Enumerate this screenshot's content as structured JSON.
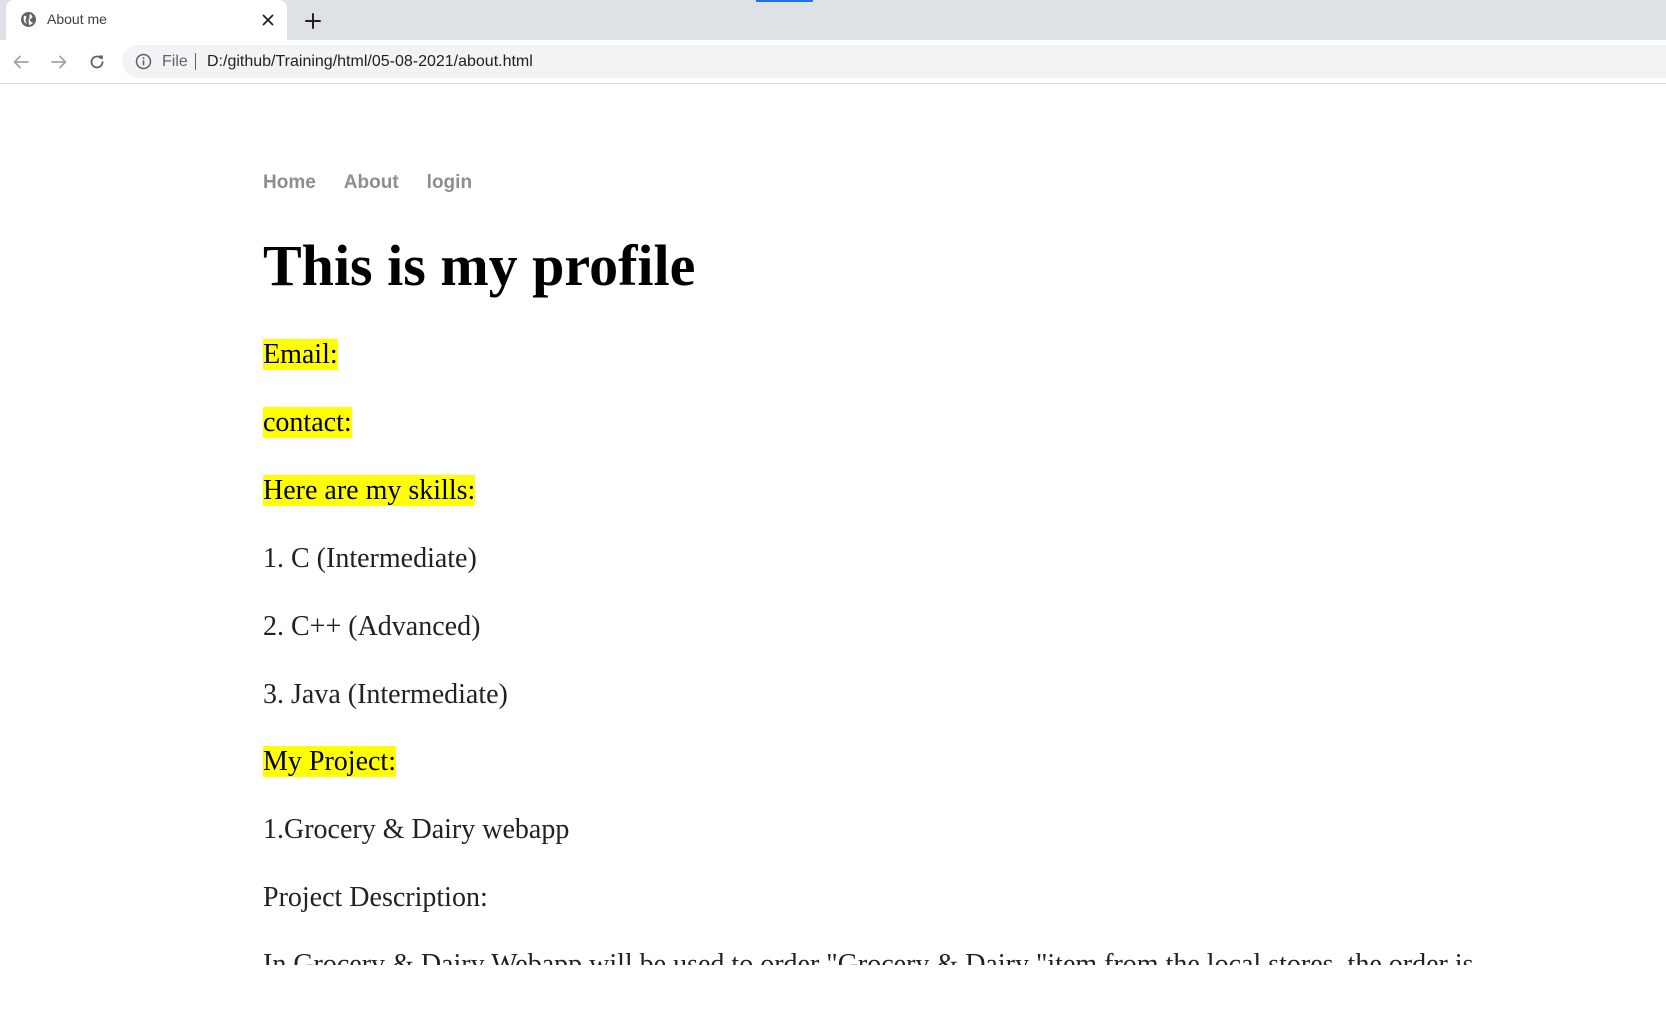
{
  "browser": {
    "tab_title": "About me",
    "url_scheme": "File",
    "url": "D:/github/Training/html/05-08-2021/about.html"
  },
  "page": {
    "nav": [
      "Home",
      "About",
      "login"
    ],
    "title": "This is my profile",
    "email_label": "Email:",
    "contact_label": "contact:",
    "skills_label": "Here are my skills:",
    "skills": [
      "1. C (Intermediate)",
      "2. C++ (Advanced)",
      "3. Java (Intermediate)"
    ],
    "project_label": "My Project:",
    "project_name": "1.Grocery & Dairy webapp",
    "project_desc_label": "Project Description:",
    "project_desc_text": "In Grocery & Dairy Webapp will be used to order \"Grocery & Dairy \"item from the local stores, the order is"
  },
  "colors": {
    "highlight": "#ffff00",
    "nav_link": "#8e8e8e",
    "tab_accent": "#1a73e8"
  }
}
